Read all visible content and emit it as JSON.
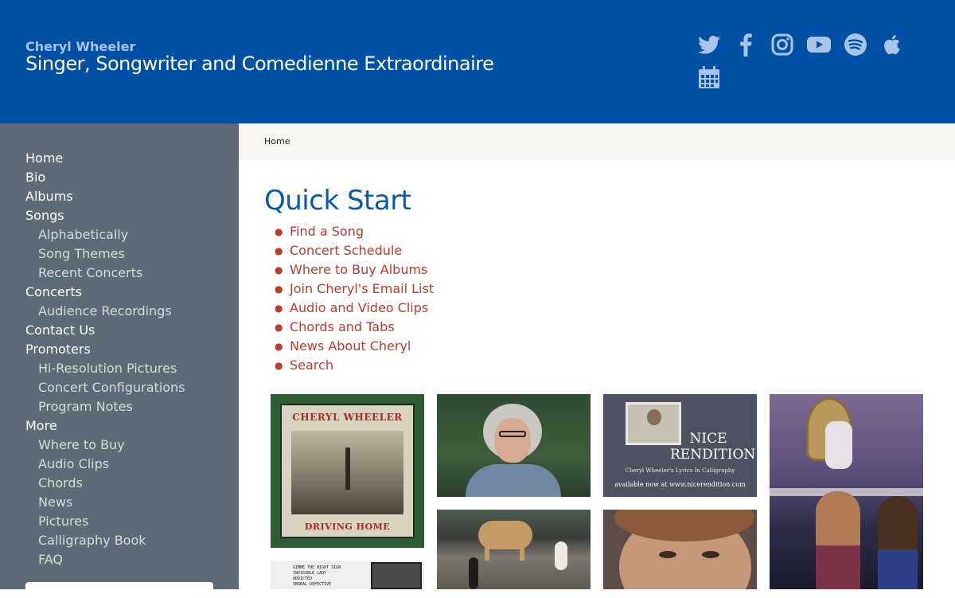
{
  "header": {
    "site_name": "Cheryl Wheeler",
    "tagline": "Singer, Songwriter and Comedienne Extraordinaire",
    "background": "#0050a5",
    "social_icons": [
      "twitter-icon",
      "facebook-icon",
      "instagram-icon",
      "youtube-icon",
      "spotify-icon",
      "apple-icon",
      "calendar-icon"
    ],
    "icon_color": "#a9c4e8"
  },
  "sidebar": {
    "background": "#5e6a75",
    "items": [
      {
        "label": "Home",
        "level": 1
      },
      {
        "label": "Bio",
        "level": 1
      },
      {
        "label": "Albums",
        "level": 1
      },
      {
        "label": "Songs",
        "level": 1
      },
      {
        "label": "Alphabetically",
        "level": 2
      },
      {
        "label": "Song Themes",
        "level": 2
      },
      {
        "label": "Recent Concerts",
        "level": 2
      },
      {
        "label": "Concerts",
        "level": 1
      },
      {
        "label": "Audience Recordings",
        "level": 2
      },
      {
        "label": "Contact Us",
        "level": 1
      },
      {
        "label": "Promoters",
        "level": 1
      },
      {
        "label": "Hi-Resolution Pictures",
        "level": 2
      },
      {
        "label": "Concert Configurations",
        "level": 2
      },
      {
        "label": "Program Notes",
        "level": 2
      },
      {
        "label": "More",
        "level": 1
      },
      {
        "label": "Where to Buy",
        "level": 2
      },
      {
        "label": "Audio Clips",
        "level": 2
      },
      {
        "label": "Chords",
        "level": 2
      },
      {
        "label": "News",
        "level": 2
      },
      {
        "label": "Pictures",
        "level": 2
      },
      {
        "label": "Calligraphy Book",
        "level": 2
      },
      {
        "label": "FAQ",
        "level": 2
      }
    ]
  },
  "breadcrumb": {
    "current": "Home"
  },
  "main": {
    "title": "Quick Start",
    "title_color": "#0a59a8",
    "link_color": "#c0392b",
    "links": [
      "Find a Song",
      "Concert Schedule",
      "Where to Buy Albums",
      "Join Cheryl's Email List",
      "Audio and Video Clips",
      "Chords and Tabs",
      "News About Cheryl",
      "Search"
    ]
  },
  "gallery": {
    "album_cover": {
      "artist": "CHERYL WHEELER",
      "title": "DRIVING HOME"
    },
    "book_ad": {
      "title": "NICE RENDITION",
      "subtitle": "Cheryl Wheeler's Lyrics In Calligraphy",
      "availability": "available now at www.nicerendition.com"
    },
    "setlist": "GIMME THE NIGHT SIGN\nINVISIBLE LADY\nADDICTED\nVERBAL DEFECTIVE"
  }
}
